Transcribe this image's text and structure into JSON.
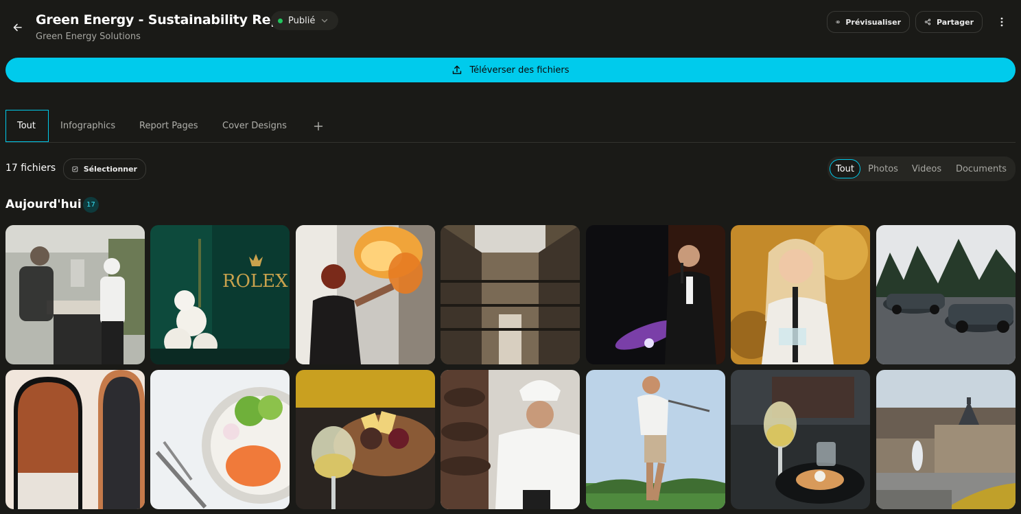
{
  "header": {
    "title": "Green Energy - Sustainability Report",
    "subtitle": "Green Energy Solutions",
    "status": "Publié",
    "status_color": "#22c55e",
    "preview_label": "Prévisualiser",
    "share_label": "Partager"
  },
  "upload": {
    "label": "Téléverser des fichiers",
    "color": "#00cbec"
  },
  "tabs": [
    {
      "label": "Tout",
      "active": true
    },
    {
      "label": "Infographics"
    },
    {
      "label": "Report Pages"
    },
    {
      "label": "Cover Designs"
    }
  ],
  "toolbar": {
    "count_label": "17 fichiers",
    "select_label": "Sélectionner",
    "filters": [
      {
        "label": "Tout",
        "active": true
      },
      {
        "label": "Photos"
      },
      {
        "label": "Videos"
      },
      {
        "label": "Documents"
      }
    ]
  },
  "section": {
    "title": "Aujourd'hui",
    "count": "17"
  },
  "photos": [
    {
      "subject": "kitchen-chef-service"
    },
    {
      "subject": "rolex-orchids-event"
    },
    {
      "subject": "fire-breather"
    },
    {
      "subject": "industrial-atrium-hall"
    },
    {
      "subject": "speaker-with-microphone"
    },
    {
      "subject": "woman-with-award"
    },
    {
      "subject": "race-cars"
    },
    {
      "subject": "hotel-room-arched-mirror"
    },
    {
      "subject": "salmon-poke-bowl"
    },
    {
      "subject": "cheese-platter-wine"
    },
    {
      "subject": "chef-chocolate-fountain"
    },
    {
      "subject": "golfer-swing"
    },
    {
      "subject": "white-wine-dinner-plate"
    },
    {
      "subject": "chateau-fountain"
    }
  ],
  "icons": {
    "back": "arrow-left-icon",
    "eye": "eye-icon",
    "share": "share-icon",
    "more": "more-vertical-icon",
    "upload": "upload-icon",
    "plus": "plus-icon",
    "checkbox": "checkbox-icon",
    "chevron": "chevron-down-icon"
  }
}
